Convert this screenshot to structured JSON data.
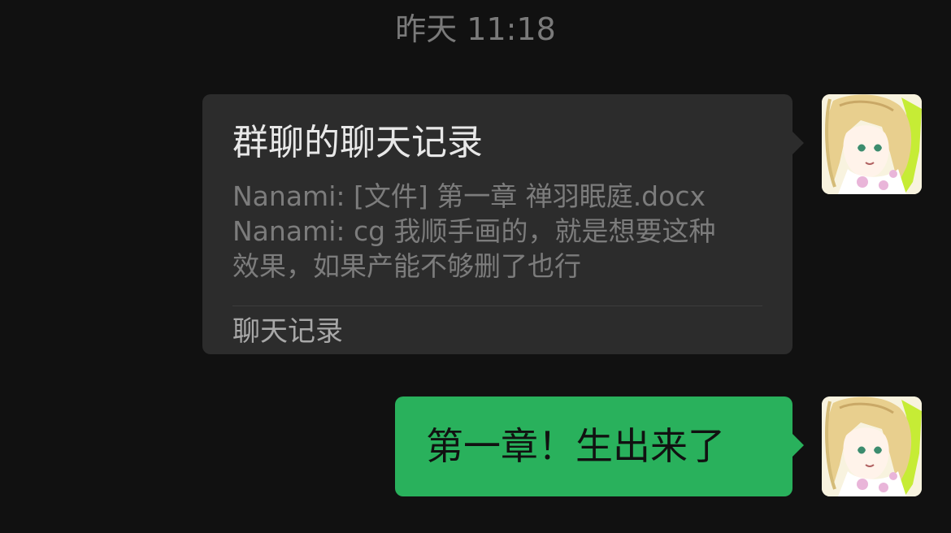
{
  "chat": {
    "timestamp": "昨天 11:18",
    "messages": [
      {
        "kind": "chat-record",
        "title": "群聊的聊天记录",
        "preview_lines": [
          "Nanami: [文件] 第一章 禅羽眠庭.docx",
          "Nanami: cg 我顺手画的，就是想要这种",
          "效果，如果产能不够删了也行"
        ],
        "footer": "聊天记录"
      },
      {
        "kind": "text",
        "text": "第一章！生出来了"
      }
    ]
  },
  "colors": {
    "background": "#111111",
    "record_card": "#2c2c2c",
    "sent_bubble": "#29b15c"
  },
  "icons": {
    "avatar": "anime-character-avatar"
  }
}
